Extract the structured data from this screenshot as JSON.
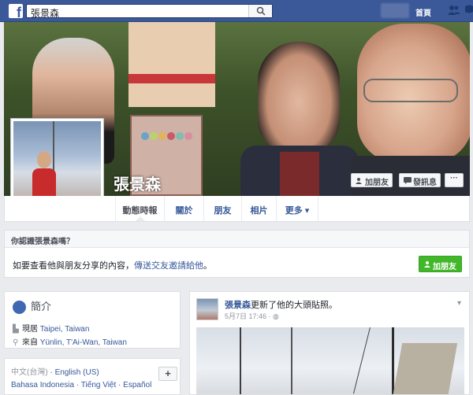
{
  "topbar": {
    "logo": "f",
    "search_value": "張景森",
    "home_label": "首頁"
  },
  "profile": {
    "name": "張景森"
  },
  "cover_actions": {
    "add_friend": "加朋友",
    "send_message": "發訊息",
    "more": "···"
  },
  "tabs": [
    {
      "label": "動態時報"
    },
    {
      "label": "關於"
    },
    {
      "label": "朋友"
    },
    {
      "label": "相片"
    },
    {
      "label": "更多 ▾"
    }
  ],
  "prompt": {
    "title": "你認識張景森嗎？",
    "text": "如要查看他與朋友分享的內容，",
    "link": "傳送交友邀請給他",
    "text_end": "。",
    "add_button": "加朋友"
  },
  "intro": {
    "title": "簡介",
    "lives_prefix": "現居 ",
    "lives_place": "Taipei, Taiwan",
    "from_prefix": "來自 ",
    "from_place": "Yünlin, T'Ai-Wan, Taiwan"
  },
  "languages": {
    "current": "中文(台灣)",
    "sep": " · ",
    "items_line1": [
      "English (US)"
    ],
    "items_line2": [
      "Bahasa Indonesia",
      "Tiếng Việt",
      "Español"
    ],
    "plus": "+"
  },
  "post": {
    "author": "張景森",
    "action": "更新了他的大頭貼照。",
    "date": "5月7日 17:46",
    "privacy_icon": "globe-icon"
  },
  "colors": {
    "brand": "#3b5998",
    "link": "#365899",
    "green": "#42b72a",
    "bg": "#e9ebee"
  }
}
